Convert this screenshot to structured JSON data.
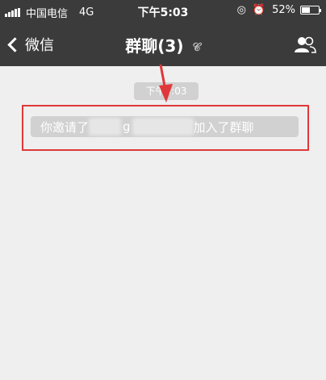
{
  "status_bar": {
    "carrier": "中国电信",
    "network": "4G",
    "time": "下午5:03",
    "battery_pct": "52%",
    "battery_level": 0.52,
    "icons": [
      "signal-icon",
      "lock-rotation-icon",
      "alarm-icon",
      "battery-icon"
    ]
  },
  "nav": {
    "back_label": "微信",
    "title": "群聊(3)",
    "icons": [
      "chevron-left-icon",
      "earpiece-icon",
      "contacts-icon"
    ]
  },
  "chat": {
    "time_stamp": "下午5:03",
    "system_message": {
      "prefix": "你邀请了",
      "visible_char": "g",
      "suffix": "加入了群聊"
    }
  },
  "annotation": {
    "box_color": "#e0383a",
    "arrow_color": "#e0383a"
  }
}
